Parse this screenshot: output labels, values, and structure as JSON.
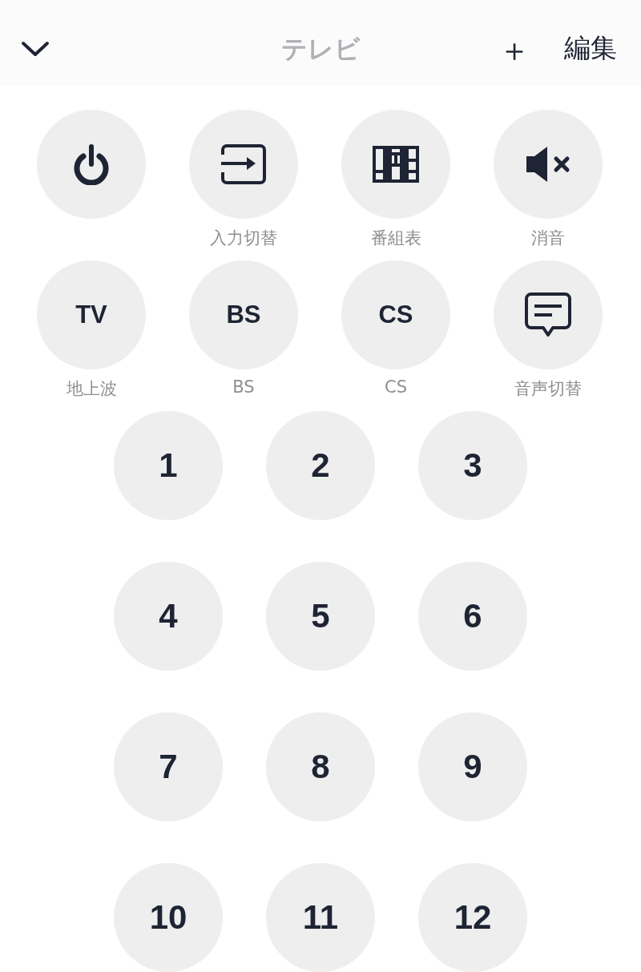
{
  "header": {
    "title": "テレビ",
    "add": "＋",
    "edit": "編集"
  },
  "function_buttons": [
    {
      "kind": "power"
    },
    {
      "kind": "input",
      "label": "入力切替"
    },
    {
      "kind": "guide",
      "label": "番組表"
    },
    {
      "kind": "mute",
      "label": "消音"
    },
    {
      "kind": "text",
      "text": "TV",
      "label": "地上波"
    },
    {
      "kind": "text",
      "text": "BS",
      "label": "BS"
    },
    {
      "kind": "text",
      "text": "CS",
      "label": "CS"
    },
    {
      "kind": "subtitle",
      "label": "音声切替"
    }
  ],
  "channel_buttons": [
    "1",
    "2",
    "3",
    "4",
    "5",
    "6",
    "7",
    "8",
    "9",
    "10",
    "11",
    "12"
  ]
}
